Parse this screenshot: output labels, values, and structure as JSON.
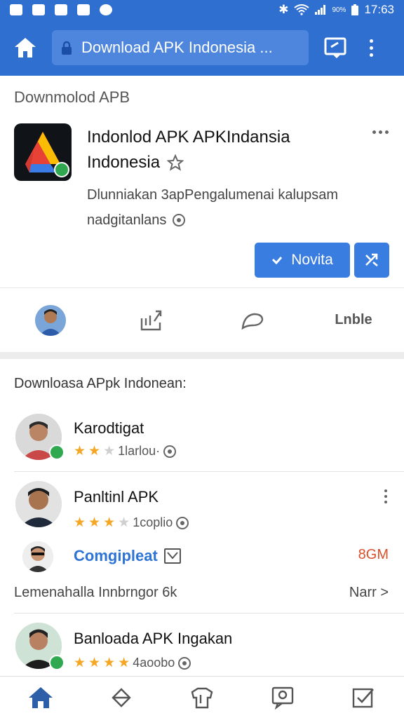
{
  "status_bar": {
    "time": "17:63",
    "battery": "90%"
  },
  "toolbar": {
    "url_text": "Download APK Indonesia ...",
    "icons": [
      "home-icon",
      "lock-icon",
      "tab-icon",
      "more-vert-icon"
    ]
  },
  "app_card": {
    "section_title": "Downmolod APB",
    "title_line1": "Indonlod APK APKIndansia",
    "title_line2": "Indonesia",
    "description_line1": "Dlunniakan 3apPengalumenai kalupsam",
    "description_line2": "nadgitanlans",
    "primary_button": "Novita",
    "colors": {
      "accent": "#3a7de0",
      "toolbar": "#2f6fd0"
    }
  },
  "actions": {
    "label": "Lnble"
  },
  "list": {
    "title": "Downloasa APpk Indonean:",
    "items": [
      {
        "name": "Karodtigat",
        "rating": 2,
        "meta": "1larlou·"
      },
      {
        "name": "Panltinl APK",
        "rating": 3.5,
        "meta": "1coplio"
      },
      {
        "name": "Banloada APK Ingakan",
        "rating": 4,
        "meta": "4aoobo"
      }
    ],
    "sub_link": "Comgipleat",
    "sub_size": "8GM",
    "more_text": "Lemenahalla Innbrngor 6k",
    "more_next": "Narr >"
  },
  "bottom_nav": [
    "home-icon",
    "diamond-icon",
    "shirt-icon",
    "chat-icon",
    "check-icon"
  ]
}
